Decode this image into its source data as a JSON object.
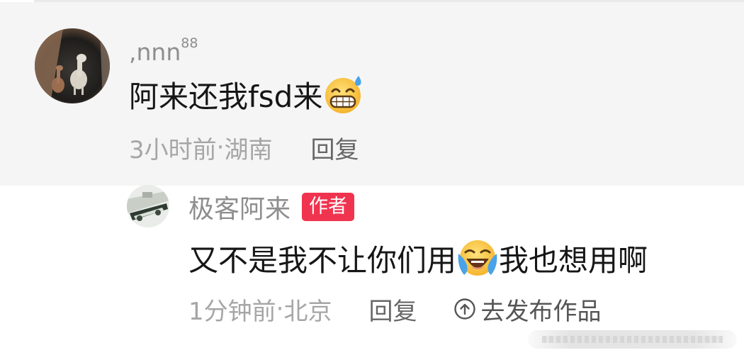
{
  "comment": {
    "username": ",nnn",
    "username_superscript": "88",
    "text_before_emoji": "阿来还我fsd来",
    "emoji_icon": "grinning-sweat-emoji",
    "time": "3小时前",
    "separator": " · ",
    "location": "湖南",
    "reply_label": "回复"
  },
  "reply": {
    "username": "极客阿来",
    "badge": "作者",
    "badge_color": "#f0334f",
    "text_before_emoji": "又不是我不让你们用",
    "emoji_icon": "loudly-crying-emoji",
    "text_after_emoji": "我也想用啊",
    "time": "1分钟前",
    "separator": " · ",
    "location": "北京",
    "reply_label": "回复",
    "publish_label": "去发布作品",
    "publish_icon": "arrow-up-circle-icon"
  }
}
